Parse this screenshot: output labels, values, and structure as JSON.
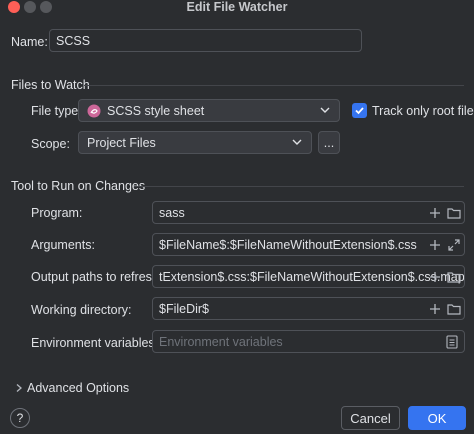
{
  "window": {
    "title": "Edit File Watcher"
  },
  "name": {
    "label": "Name:",
    "value": "SCSS"
  },
  "files_to_watch": {
    "heading": "Files to Watch",
    "file_type_label": "File type:",
    "file_type_value": "SCSS style sheet",
    "track_root_label": "Track only root files",
    "track_root_checked": true,
    "scope_label": "Scope:",
    "scope_value": "Project Files",
    "scope_more": "..."
  },
  "tool": {
    "heading": "Tool to Run on Changes",
    "program_label": "Program:",
    "program_value": "sass",
    "arguments_label": "Arguments:",
    "arguments_value": "$FileName$:$FileNameWithoutExtension$.css",
    "output_label": "Output paths to refresh:",
    "output_value": "tExtension$.css:$FileNameWithoutExtension$.css.map",
    "workdir_label": "Working directory:",
    "workdir_value": "$FileDir$",
    "env_label": "Environment variables:",
    "env_placeholder": "Environment variables"
  },
  "advanced": {
    "label": "Advanced Options"
  },
  "footer": {
    "help": "?",
    "cancel": "Cancel",
    "ok": "OK"
  },
  "colors": {
    "accent": "#3574f0",
    "background": "#2b2d30",
    "scss_icon": "#cd6799"
  }
}
